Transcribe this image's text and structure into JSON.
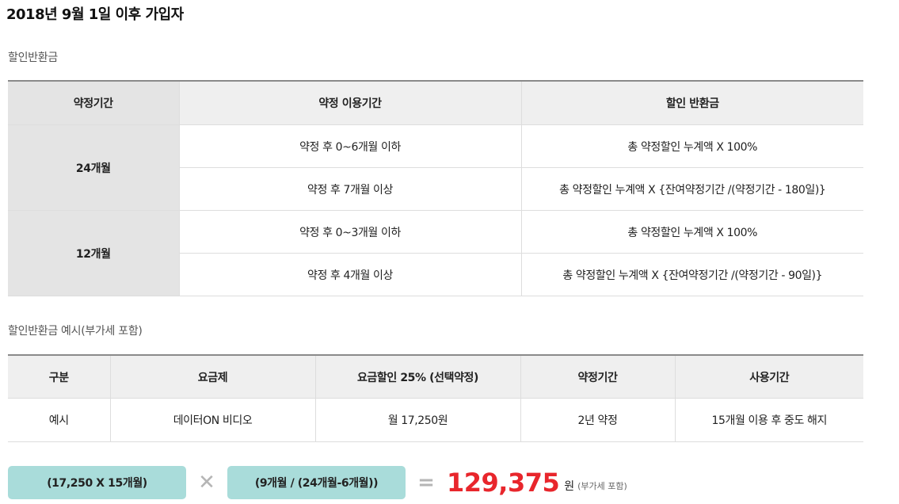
{
  "page_title": "2018년 9월 1일 이후 가입자",
  "refund_section": {
    "label": "할인반환금",
    "headers": [
      "약정기간",
      "약정 이용기간",
      "할인 반환금"
    ],
    "groups": [
      {
        "term": "24개월",
        "rows": [
          {
            "usage": "약정 후 0~6개월 이하",
            "refund": "총 약정할인 누계액 X 100%"
          },
          {
            "usage": "약정 후 7개월 이상",
            "refund": "총 약정할인 누계액 X {잔여약정기간 /(약정기간 - 180일)}"
          }
        ]
      },
      {
        "term": "12개월",
        "rows": [
          {
            "usage": "약정 후 0~3개월 이하",
            "refund": "총 약정할인 누계액 X 100%"
          },
          {
            "usage": "약정 후 4개월 이상",
            "refund": "총 약정할인 누계액 X {잔여약정기간 /(약정기간 - 90일)}"
          }
        ]
      }
    ]
  },
  "example_section": {
    "label": "할인반환금 예시(부가세 포함)",
    "headers": [
      "구분",
      "요금제",
      "요금할인 25% (선택약정)",
      "약정기간",
      "사용기간"
    ],
    "row": [
      "예시",
      "데이터ON 비디오",
      "월 17,250원",
      "2년 약정",
      "15개월 이용 후 중도 해지"
    ]
  },
  "formula": {
    "left_term": "(17,250 X 15개월)",
    "times_symbol": "✕",
    "right_term": "(9개월 / (24개월-6개월))",
    "equals_symbol": "=",
    "result_value": "129,375",
    "result_unit": "원",
    "result_note": "(부가세 포함)"
  },
  "colors": {
    "pill_background": "#a9dcda",
    "result_red": "#e8262c",
    "header_gray": "#efefef",
    "term_gray": "#e4e4e4"
  }
}
